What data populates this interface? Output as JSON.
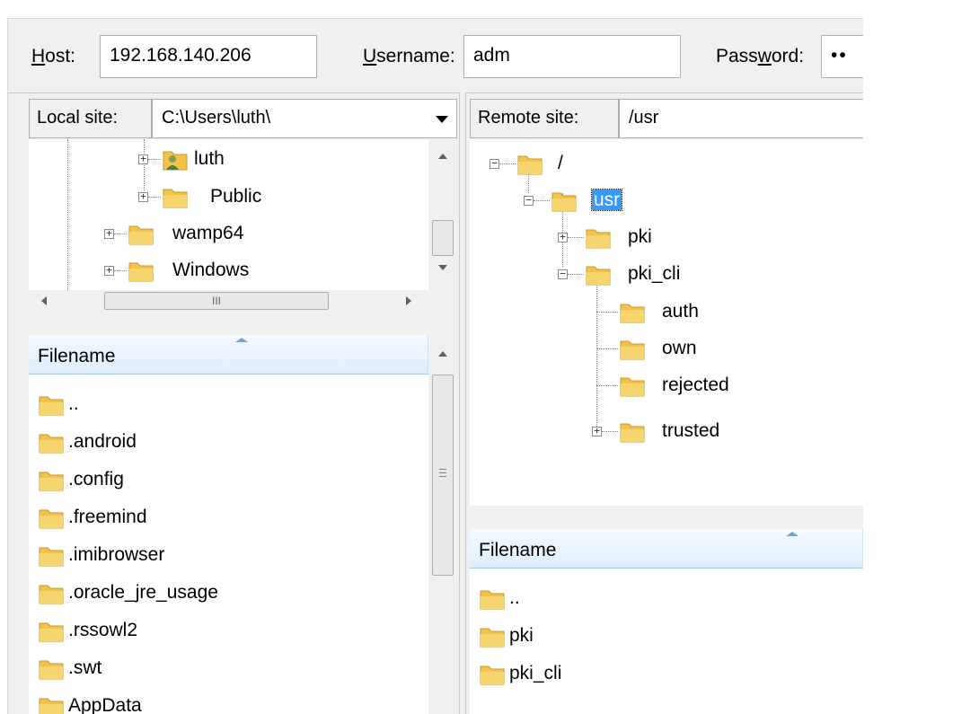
{
  "quickconnect": {
    "host_label_u": "H",
    "host_label_rest": "ost:",
    "host_value": "192.168.140.206",
    "username_label_u": "U",
    "username_label_rest": "sername:",
    "username_value": "adm",
    "password_label_pre": "Pass",
    "password_label_u": "w",
    "password_label_post": "ord:",
    "password_mask": "••"
  },
  "local": {
    "site_label": "Local site:",
    "site_path": "C:\\Users\\luth\\",
    "tree": [
      {
        "label": "luth",
        "icon": "user-folder-icon"
      },
      {
        "label": "Public",
        "icon": "folder-icon"
      },
      {
        "label": "wamp64",
        "icon": "folder-icon"
      },
      {
        "label": "Windows",
        "icon": "folder-icon"
      }
    ],
    "hscroll_grip": "III",
    "list_header": "Filename",
    "files": [
      "..",
      ".android",
      ".config",
      ".freemind",
      ".imibrowser",
      ".oracle_jre_usage",
      ".rssowl2",
      ".swt",
      "AppData"
    ]
  },
  "remote": {
    "site_label": "Remote site:",
    "site_path": "/usr",
    "tree": [
      {
        "label": "/"
      },
      {
        "label": "usr"
      },
      {
        "label": "pki"
      },
      {
        "label": "pki_cli"
      },
      {
        "label": "auth"
      },
      {
        "label": "own"
      },
      {
        "label": "rejected"
      },
      {
        "label": "trusted"
      }
    ],
    "list_header": "Filename",
    "files": [
      "..",
      "pki",
      "pki_cli"
    ]
  },
  "colors": {
    "folder": "#f2c24b",
    "selection": "#3399ff"
  }
}
